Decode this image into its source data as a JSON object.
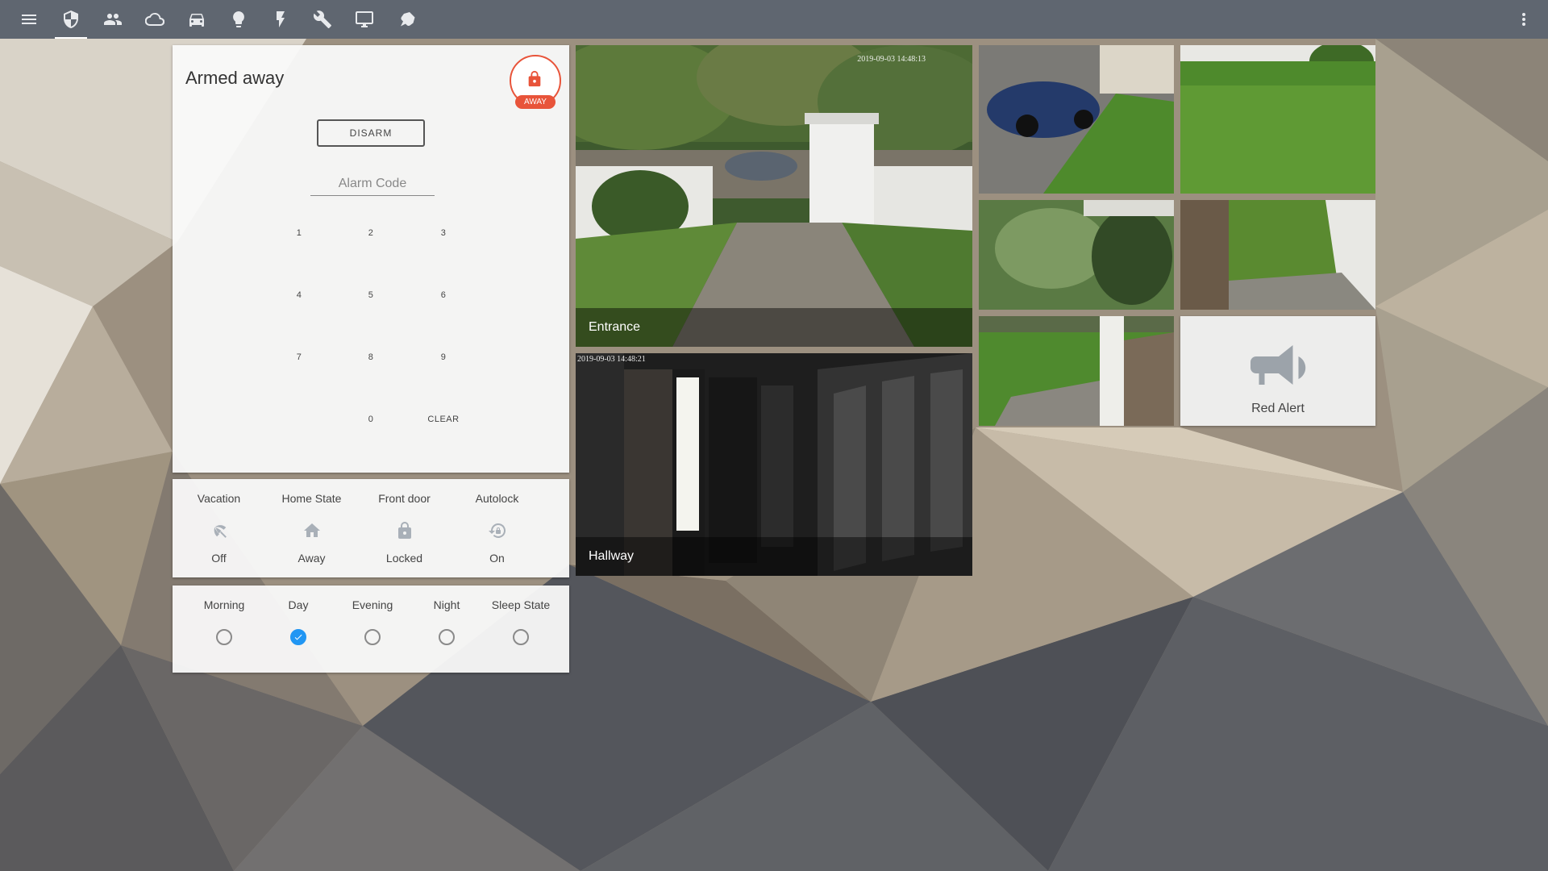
{
  "topbar": {
    "tabs": [
      {
        "icon": "menu-icon"
      },
      {
        "icon": "shield-icon",
        "active": true
      },
      {
        "icon": "people-icon"
      },
      {
        "icon": "cloud-icon"
      },
      {
        "icon": "car-icon"
      },
      {
        "icon": "lightbulb-icon"
      },
      {
        "icon": "flash-icon"
      },
      {
        "icon": "wrench-icon"
      },
      {
        "icon": "monitor-icon"
      },
      {
        "icon": "pin-icon"
      }
    ],
    "overflow_icon": "more-vert-icon"
  },
  "alarm": {
    "title": "Armed away",
    "badge_label": "AWAY",
    "badge_icon": "lock-icon",
    "badge_color": "#e8543a",
    "disarm_label": "DISARM",
    "code_placeholder": "Alarm Code",
    "code_value": "",
    "keys": [
      "1",
      "2",
      "3",
      "4",
      "5",
      "6",
      "7",
      "8",
      "9",
      "0",
      "CLEAR"
    ]
  },
  "status": [
    {
      "title": "Vacation",
      "icon": "beach-icon",
      "value": "Off"
    },
    {
      "title": "Home State",
      "icon": "home-icon",
      "value": "Away"
    },
    {
      "title": "Front door",
      "icon": "lock-icon",
      "value": "Locked"
    },
    {
      "title": "Autolock",
      "icon": "lock-reset-icon",
      "value": "On"
    }
  ],
  "modes": [
    {
      "title": "Morning",
      "checked": false
    },
    {
      "title": "Day",
      "checked": true
    },
    {
      "title": "Evening",
      "checked": false
    },
    {
      "title": "Night",
      "checked": false
    },
    {
      "title": "Sleep State",
      "checked": false
    }
  ],
  "cameras": {
    "entrance": {
      "caption": "Entrance",
      "timestamp": "2019-09-03 14:48:13"
    },
    "hallway": {
      "caption": "Hallway",
      "timestamp": "2019-09-03 14:48:21"
    }
  },
  "red_alert": {
    "label": "Red Alert",
    "icon": "megaphone-icon"
  },
  "colors": {
    "topbar": "#5f6670",
    "accent": "#2196f3",
    "alarm_red": "#e8543a"
  }
}
